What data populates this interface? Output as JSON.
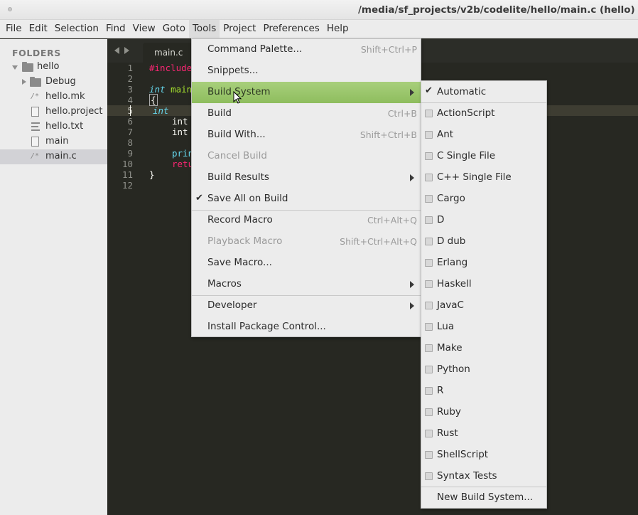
{
  "window": {
    "title": "/media/sf_projects/v2b/codelite/hello/main.c (hello) -"
  },
  "menubar": {
    "items": [
      "File",
      "Edit",
      "Selection",
      "Find",
      "View",
      "Goto",
      "Tools",
      "Project",
      "Preferences",
      "Help"
    ],
    "active": "Tools"
  },
  "sidebar": {
    "header": "FOLDERS",
    "tree": [
      {
        "label": "hello",
        "icon": "folder-icon",
        "expanded": true
      },
      {
        "label": "Debug",
        "icon": "folder-icon",
        "expanded": false
      },
      {
        "label": "hello.mk",
        "icon": "code-file-icon"
      },
      {
        "label": "hello.project",
        "icon": "file-icon"
      },
      {
        "label": "hello.txt",
        "icon": "text-file-icon"
      },
      {
        "label": "main",
        "icon": "file-icon"
      },
      {
        "label": "main.c",
        "icon": "code-file-icon",
        "selected": true
      }
    ]
  },
  "tabs": {
    "active_label": "main.c"
  },
  "editor": {
    "line_numbers": [
      "1",
      "2",
      "3",
      "4",
      "5",
      "6",
      "7",
      "8",
      "9",
      "10",
      "11",
      "12"
    ],
    "current_line": "5",
    "code": {
      "l1": "#include",
      "l3_kw": "int",
      "l3_fn": "main",
      "l4": "{",
      "l5_kw": "int",
      "l6": "int",
      "l7": "int",
      "l9": "prin",
      "l10": "retu",
      "l11": "}"
    }
  },
  "tools_menu": {
    "items": [
      {
        "label": "Command Palette...",
        "shortcut": "Shift+Ctrl+P"
      },
      {
        "label": "Snippets..."
      },
      {
        "label": "Build System",
        "submenu": true,
        "highlighted": true
      },
      {
        "label": "Build",
        "shortcut": "Ctrl+B"
      },
      {
        "label": "Build With...",
        "shortcut": "Shift+Ctrl+B"
      },
      {
        "label": "Cancel Build",
        "disabled": true
      },
      {
        "label": "Build Results",
        "submenu": true
      },
      {
        "label": "Save All on Build",
        "checked": true
      },
      {
        "label": "Record Macro",
        "shortcut": "Ctrl+Alt+Q"
      },
      {
        "label": "Playback Macro",
        "shortcut": "Shift+Ctrl+Alt+Q",
        "disabled": true
      },
      {
        "label": "Save Macro..."
      },
      {
        "label": "Macros",
        "submenu": true
      },
      {
        "label": "Developer",
        "submenu": true
      },
      {
        "label": "Install Package Control..."
      }
    ]
  },
  "build_system_menu": {
    "items": [
      {
        "label": "Automatic",
        "checked": true
      },
      {
        "label": "ActionScript"
      },
      {
        "label": "Ant"
      },
      {
        "label": "C Single File"
      },
      {
        "label": "C++ Single File"
      },
      {
        "label": "Cargo"
      },
      {
        "label": "D"
      },
      {
        "label": "D dub"
      },
      {
        "label": "Erlang"
      },
      {
        "label": "Haskell"
      },
      {
        "label": "JavaC"
      },
      {
        "label": "Lua"
      },
      {
        "label": "Make"
      },
      {
        "label": "Python"
      },
      {
        "label": "R"
      },
      {
        "label": "Ruby"
      },
      {
        "label": "Rust"
      },
      {
        "label": "ShellScript"
      },
      {
        "label": "Syntax Tests"
      },
      {
        "label": "New Build System..."
      }
    ]
  },
  "colors": {
    "editor_bg": "#272822",
    "highlight_green": "#9cc66d",
    "menu_bg": "#ececec"
  }
}
